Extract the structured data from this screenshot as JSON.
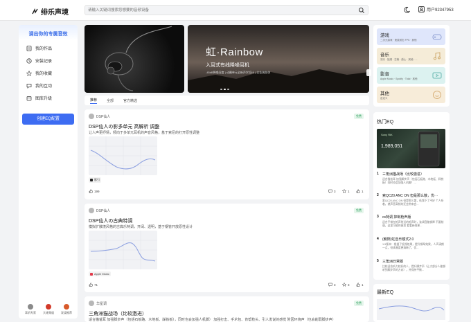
{
  "app": {
    "logo_text": "绯乐声境"
  },
  "search": {
    "placeholder": "请输入关键词搜索您想要的音频设备",
    "icon": "search-icon"
  },
  "user": {
    "name": "用户92347953"
  },
  "sidebar": {
    "title": "调出你的专属音效",
    "items": [
      {
        "label": "我的作品",
        "icon": "document-icon"
      },
      {
        "label": "安装记录",
        "icon": "history-icon"
      },
      {
        "label": "我的收藏",
        "icon": "star-icon"
      },
      {
        "label": "我的互动",
        "icon": "comment-icon"
      },
      {
        "label": "图库升级",
        "icon": "calendar-icon"
      }
    ],
    "cta": "创建EQ配置",
    "footer": [
      {
        "label": "耳机专家",
        "color": "#8a8a8a"
      },
      {
        "label": "大佬频道",
        "color": "#d23a2a"
      },
      {
        "label": "发烧推荐",
        "color": "#d85a2a"
      }
    ]
  },
  "banner": {
    "title": "虹·Rainbow",
    "subtitle": "入耳式有线降噪耳机",
    "tagline": "-45dB降噪深度 | 动圈单元全新声学设计 | 全金属腔体"
  },
  "tabs": {
    "items": [
      "推荐",
      "全部",
      "官方精选"
    ],
    "active": 0
  },
  "posts": [
    {
      "author": "DSP仙人",
      "badge": "免费",
      "title": "DSP仙人の影多单元 高解析 调整",
      "desc": "让人声更抒情，倾向于多单元耳机的声音风格，基于索尼的打开原性调整",
      "source": "影引",
      "source_color": "#222",
      "likes": "199",
      "comments": "3",
      "stars": "1",
      "thumbs": "1"
    },
    {
      "author": "DSP仙人",
      "badge": "免费",
      "title": "DSP仙人の古典特调",
      "desc": "模拟扩散境风格的古典乐特调，开阔、透明，基于钢管开放原性设计",
      "source": "Apple Music",
      "source_color": "#e23a4a",
      "likes": "71",
      "comments": "3",
      "stars": "3",
      "thumbs": "1"
    },
    {
      "author": "华星调",
      "badge": "免费",
      "title": "三角洲猫战场（比较激进）",
      "desc": "适合猫爸耳 加强脚步声（包括石板路、木地板、踩铁板），同时也会加强人机脚） 加强打击、手术包、肯帮枪头、引人发说的感觉 附因环境声（也会削弱脚步声）"
    }
  ],
  "categories": [
    {
      "name": "游戏",
      "sub": "二次元游戏 · 竞技射击 FPS · 其他",
      "bg": "#dfe6fb",
      "icon": "gamepad-icon"
    },
    {
      "name": "音乐",
      "sub": "流行 · 摇滚 · 古典 · 爵士 · 其他 · ...",
      "bg": "#f5ecd8",
      "icon": "music-icon"
    },
    {
      "name": "影音",
      "sub": "Apple Music · Spotify · Tidal · 其他",
      "bg": "#dcf2f0",
      "icon": "video-icon"
    },
    {
      "name": "其他",
      "sub": "自定义",
      "bg": "#f7ecd9",
      "icon": "smile-icon"
    }
  ],
  "hot_eq": {
    "title": "热门EQ",
    "image_caption": "Sony RiK",
    "image_value": "1,989,051",
    "items": [
      {
        "rank": "1",
        "title": "三角洲猫战场（比较激进）",
        "desc": "适合猫爸耳 加强脚步声（包括石板路、木地板、踩铁板）同时也会加强人机脚！..."
      },
      {
        "rank": "2",
        "title": "索QC20 ANC ON 但是那么散，优···",
        "desc": "索QC20 ANC ON 但是那么散，低频下了不好 个人听着，就声音高频的还会带来会..."
      },
      {
        "rank": "3",
        "title": "cs特调 抑制枪声版",
        "desc": "适合平常在枪声附近的枪声时，该调音能够降 不要削弱，这里可能的意思 看看新效果..."
      },
      {
        "rank": "4",
        "title": "(朝阳)虹音乐模式2.0",
        "desc": "1.5版本：根据了低频效果，提升钢琴效果，人声清朗一点，但清澈度更清晰了，优..."
      },
      {
        "rank": "5",
        "title": "三角洲日常版",
        "desc": "比较适合听力较好的人，提升脚步声（让大部分人能够听到脚步声的方向），并保持平衡..."
      }
    ]
  },
  "newest": {
    "title": "最新EQ"
  }
}
